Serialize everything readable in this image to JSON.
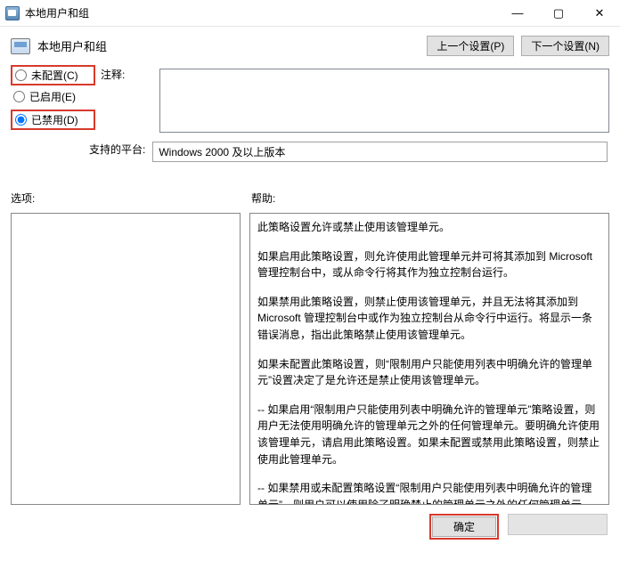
{
  "titlebar": {
    "title": "本地用户和组"
  },
  "header": {
    "label": "本地用户和组",
    "prev": "上一个设置(P)",
    "next": "下一个设置(N)"
  },
  "radios": {
    "not_configured": "未配置(C)",
    "enabled": "已启用(E)",
    "disabled": "已禁用(D)"
  },
  "note": {
    "label": "注释:",
    "value": ""
  },
  "platform": {
    "label": "支持的平台:",
    "value": "Windows 2000 及以上版本"
  },
  "columns": {
    "options": "选项:",
    "help": "帮助:"
  },
  "help": {
    "p1": "此策略设置允许或禁止使用该管理单元。",
    "p2": "如果启用此策略设置，则允许使用此管理单元并可将其添加到 Microsoft 管理控制台中，或从命令行将其作为独立控制台运行。",
    "p3": "如果禁用此策略设置，则禁止使用该管理单元，并且无法将其添加到 Microsoft 管理控制台中或作为独立控制台从命令行中运行。将显示一条错误消息，指出此策略禁止使用该管理单元。",
    "p4": "如果未配置此策略设置，则“限制用户只能使用列表中明确允许的管理单元”设置决定了是允许还是禁止使用该管理单元。",
    "p5": "-- 如果启用“限制用户只能使用列表中明确允许的管理单元”策略设置，则用户无法使用明确允许的管理单元之外的任何管理单元。要明确允许使用该管理单元，请启用此策略设置。如果未配置或禁用此策略设置，则禁止使用此管理单元。",
    "p6": "-- 如果禁用或未配置策略设置“限制用户只能使用列表中明确允许的管理单元”，则用户可以使用除了明确禁止的管理单元之外的任何管理单元"
  },
  "footer": {
    "ok": "确定"
  }
}
